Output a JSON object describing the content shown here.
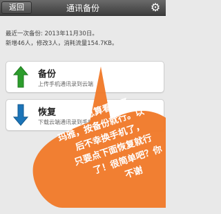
{
  "header": {
    "back_label": "返回",
    "title": "通讯备份",
    "settings_icon": "gear-icon"
  },
  "backup_info": {
    "line1": "最近一次备份: 2013年11月30日。",
    "line2": "新增46人，修改3人，消耗流量154.7KB。"
  },
  "actions": [
    {
      "title": "备份",
      "subtitle": "上传手机通讯录到云端",
      "icon": "up-arrow-icon"
    },
    {
      "title": "恢复",
      "subtitle": "下载云端通讯录到手机",
      "icon": "down-arrow-icon"
    }
  ],
  "overlay": {
    "lines": [
      "总算看到了",
      "玛雅，按备份就行。以",
      "后不幸换手机了，",
      "只要点下面恢复就行",
      "了！很简单吧？你",
      "不谢"
    ]
  },
  "colors": {
    "overlay_orange": "#f07a2a",
    "up_arrow_green": "#2c9d2c",
    "down_arrow_blue": "#1b74b8"
  }
}
